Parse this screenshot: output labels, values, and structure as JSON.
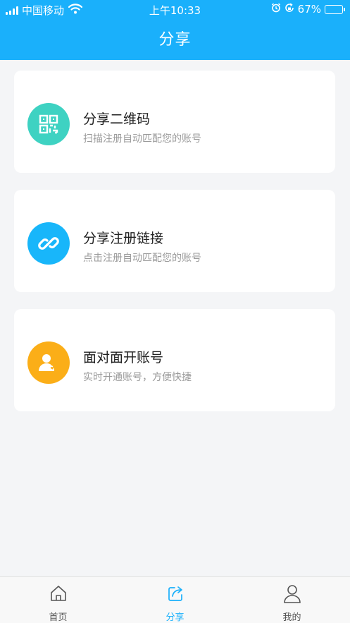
{
  "status_bar": {
    "carrier": "中国移动",
    "time": "上午10:33",
    "battery": "67%",
    "battery_level": 0.67
  },
  "header": {
    "title": "分享"
  },
  "cards": [
    {
      "title": "分享二维码",
      "subtitle": "扫描注册自动匹配您的账号",
      "icon": "qr-code-icon",
      "color": "#3ed2c2"
    },
    {
      "title": "分享注册链接",
      "subtitle": "点击注册自动匹配您的账号",
      "icon": "link-icon",
      "color": "#18b6fa"
    },
    {
      "title": "面对面开账号",
      "subtitle": "实时开通账号，方便快捷",
      "icon": "user-exchange-icon",
      "color": "#fbae18"
    }
  ],
  "tabbar": {
    "items": [
      {
        "label": "首页",
        "icon": "home-icon",
        "active": false
      },
      {
        "label": "分享",
        "icon": "share-icon",
        "active": true
      },
      {
        "label": "我的",
        "icon": "person-icon",
        "active": false
      }
    ],
    "active_color": "#1ab0fb"
  }
}
